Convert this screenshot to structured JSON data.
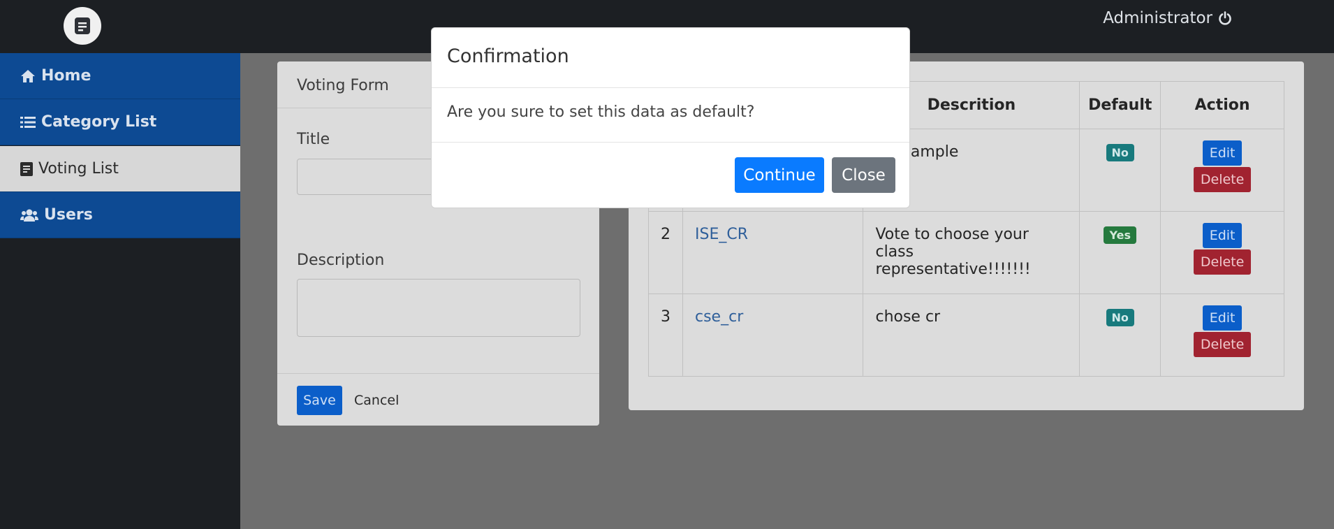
{
  "header": {
    "user_label": "Administrator",
    "logo_icon": "document-icon",
    "power_icon": "power-icon"
  },
  "sidebar": {
    "items": [
      {
        "label": "Home",
        "icon": "home-icon",
        "active": false
      },
      {
        "label": "Category List",
        "icon": "list-icon",
        "active": false
      },
      {
        "label": "Voting List",
        "icon": "document-icon",
        "active": true
      },
      {
        "label": "Users",
        "icon": "users-icon",
        "active": false
      }
    ]
  },
  "form": {
    "title": "Voting Form",
    "title_label": "Title",
    "title_value": "",
    "description_label": "Description",
    "description_value": "",
    "save_label": "Save",
    "cancel_label": "Cancel"
  },
  "table": {
    "headers": [
      "Descrition",
      "Default",
      "Action"
    ],
    "rows": [
      {
        "num": "",
        "title": "",
        "description": "s a sample",
        "default": "No",
        "edit": "Edit",
        "delete": "Delete"
      },
      {
        "num": "2",
        "title": "ISE_CR",
        "description": "Vote to choose your class representative!!!!!!!",
        "default": "Yes",
        "edit": "Edit",
        "delete": "Delete"
      },
      {
        "num": "3",
        "title": "cse_cr",
        "description": "chose cr",
        "default": "No",
        "edit": "Edit",
        "delete": "Delete"
      }
    ]
  },
  "modal": {
    "title": "Confirmation",
    "message": "Are you sure to set this data as default?",
    "continue_label": "Continue",
    "close_label": "Close"
  },
  "colors": {
    "primary": "#0a7bff",
    "secondary": "#6c747d",
    "sidebar_active": "#d7d7d7",
    "sidebar_item": "#0d4a93",
    "badge_no": "#187a7d",
    "badge_yes": "#257a3e",
    "danger": "#a12330"
  }
}
